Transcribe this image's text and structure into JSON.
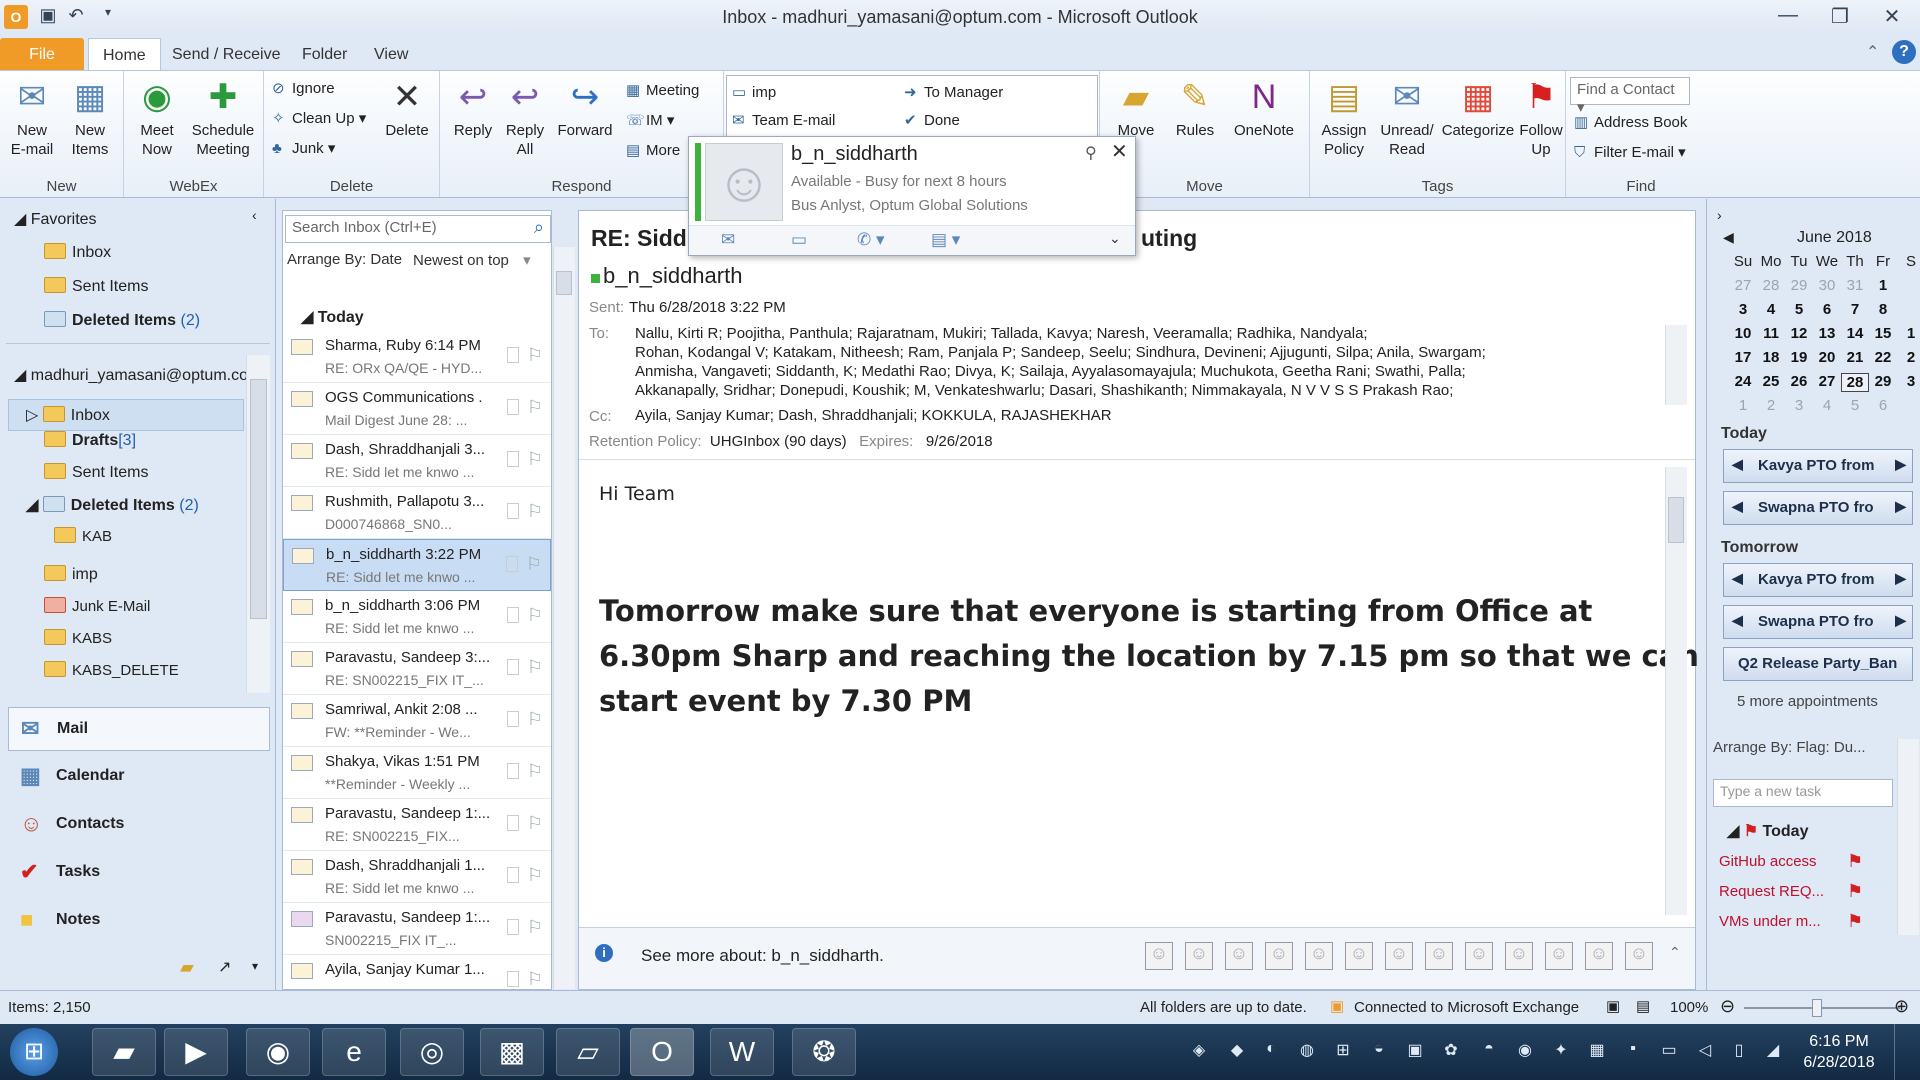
{
  "window": {
    "title": "Inbox - madhuri_yamasani@optum.com - Microsoft Outlook"
  },
  "tabs": [
    "File",
    "Home",
    "Send / Receive",
    "Folder",
    "View"
  ],
  "ribbon": {
    "new": {
      "new_email": "New\nE-mail",
      "new_items": "New\nItems",
      "label": "New"
    },
    "webex": {
      "meet_now": "Meet\nNow",
      "schedule": "Schedule\nMeeting",
      "label": "WebEx"
    },
    "delete": {
      "ignore": "Ignore",
      "clean_up": "Clean Up",
      "junk": "Junk",
      "delete": "Delete",
      "label": "Delete"
    },
    "respond": {
      "reply": "Reply",
      "reply_all": "Reply\nAll",
      "forward": "Forward",
      "meeting": "Meeting",
      "im": "IM",
      "more": "More",
      "label": "Respond"
    },
    "quick_steps": [
      "imp",
      "To Manager",
      "Team E-mail",
      "Done"
    ],
    "move": {
      "move": "Move",
      "rules": "Rules",
      "onenote": "OneNote",
      "label": "Move"
    },
    "tags": {
      "assign_policy": "Assign\nPolicy",
      "unread_read": "Unread/\nRead",
      "categorize": "Categorize",
      "follow_up": "Follow\nUp",
      "label": "Tags"
    },
    "find": {
      "find_contact": "Find a Contact",
      "address_book": "Address Book",
      "filter_email": "Filter E-mail",
      "label": "Find"
    }
  },
  "nav": {
    "favorites": "Favorites",
    "fav_items": [
      {
        "label": "Inbox"
      },
      {
        "label": "Sent Items"
      },
      {
        "label": "Deleted Items",
        "count": "(2)"
      }
    ],
    "account": "madhuri_yamasani@optum.co",
    "folders": [
      {
        "label": "Inbox"
      },
      {
        "label": "Drafts",
        "count": "[3]"
      },
      {
        "label": "Sent Items"
      },
      {
        "label": "Deleted Items",
        "count": "(2)"
      },
      {
        "label": "KAB"
      },
      {
        "label": "imp"
      },
      {
        "label": "Junk E-Mail"
      },
      {
        "label": "KABS"
      },
      {
        "label": "KABS_DELETE"
      }
    ],
    "modules": [
      "Mail",
      "Calendar",
      "Contacts",
      "Tasks",
      "Notes"
    ]
  },
  "list": {
    "search_placeholder": "Search Inbox (Ctrl+E)",
    "arrange": "Arrange By: Date",
    "order": "Newest on top",
    "group": "Today",
    "messages": [
      {
        "from": "Sharma, Ruby 6:14 PM",
        "subject": "RE: ORx QA/QE - HYD..."
      },
      {
        "from": "OGS Communications .",
        "subject": "Mail Digest June 28: ..."
      },
      {
        "from": "Dash, Shraddhanjali 3...",
        "subject": "RE: Sidd let me knwo ..."
      },
      {
        "from": "Rushmith, Pallapotu 3...",
        "subject": "D000746868_SN0..."
      },
      {
        "from": "b_n_siddharth  3:22 PM",
        "subject": "RE: Sidd let me knwo ..."
      },
      {
        "from": "b_n_siddharth  3:06 PM",
        "subject": "RE: Sidd let me knwo ..."
      },
      {
        "from": "Paravastu, Sandeep 3:...",
        "subject": "RE: SN002215_FIX IT_..."
      },
      {
        "from": "Samriwal, Ankit  2:08 ...",
        "subject": "FW: **Reminder - We..."
      },
      {
        "from": "Shakya, Vikas  1:51 PM",
        "subject": "**Reminder - Weekly ..."
      },
      {
        "from": "Paravastu, Sandeep 1:...",
        "subject": "RE: SN002215_FIX..."
      },
      {
        "from": "Dash, Shraddhanjali 1...",
        "subject": "RE: Sidd let me knwo ..."
      },
      {
        "from": "Paravastu, Sandeep 1:...",
        "subject": "SN002215_FIX IT_..."
      },
      {
        "from": "Ayila, Sanjay Kumar 1...",
        "subject": ""
      }
    ]
  },
  "reading": {
    "subject_left": "RE: Sidd",
    "subject_right": "uting",
    "sender": "b_n_siddharth",
    "sent_label": "Sent:",
    "sent": "Thu 6/28/2018 3:22 PM",
    "to_label": "To:",
    "to_lines": [
      "Nallu, Kirti R; Poojitha, Panthula; Rajaratnam, Mukiri; Tallada, Kavya; Naresh, Veeramalla; Radhika, Nandyala;",
      "Rohan, Kodangal V; Katakam, Nitheesh; Ram, Panjala P; Sandeep, Seelu; Sindhura, Devineni; Ajjugunti, Silpa; Anila, Swargam;",
      "Anmisha, Vangaveti; Siddanth, K; Medathi Rao; Divya, K; Sailaja, Ayyalasomayajula; Muchukota, Geetha Rani; Swathi, Palla;",
      "Akkanapally, Sridhar; Donepudi, Koushik; M, Venkateshwarlu; Dasari, Shashikanth; Nimmakayala, N V V S S Prakash Rao;"
    ],
    "cc_label": "Cc:",
    "cc": "Ayila, Sanjay Kumar; Dash, Shraddhanjali; KOKKULA, RAJASHEKHAR",
    "retention_label": "Retention Policy:",
    "retention": "UHGInbox (90 days)",
    "expires_label": "Expires:",
    "expires": "9/26/2018",
    "greeting": "Hi Team",
    "body_lines": [
      "Tomorrow make sure that everyone is starting  from Office at",
      "6.30pm  Sharp  and reaching  the location  by 7.15 pm so that we can",
      "start event by 7.30 PM"
    ],
    "see_more": "See more about: b_n_siddharth."
  },
  "card": {
    "name": "b_n_siddharth",
    "status": "Available - Busy for next 8 hours",
    "title": "Bus Anlyst, Optum Global Solutions"
  },
  "todo": {
    "month": "June 2018",
    "weekdays": [
      "Su",
      "Mo",
      "Tu",
      "We",
      "Th",
      "Fr",
      "S"
    ],
    "weeks": [
      [
        "27",
        "28",
        "29",
        "30",
        "31",
        "1",
        ""
      ],
      [
        "3",
        "4",
        "5",
        "6",
        "7",
        "8",
        ""
      ],
      [
        "10",
        "11",
        "12",
        "13",
        "14",
        "15",
        "1"
      ],
      [
        "17",
        "18",
        "19",
        "20",
        "21",
        "22",
        "2"
      ],
      [
        "24",
        "25",
        "26",
        "27",
        "28",
        "29",
        "3"
      ],
      [
        "1",
        "2",
        "3",
        "4",
        "5",
        "6",
        ""
      ]
    ],
    "today_label": "Today",
    "today_appts": [
      "Kavya PTO from",
      "Swapna PTO fro"
    ],
    "tomorrow_label": "Tomorrow",
    "tomorrow_appts": [
      "Kavya PTO from",
      "Swapna PTO fro",
      "Q2 Release  Party_Ban"
    ],
    "more_appts": "5 more appointments",
    "arrange": "Arrange By: Flag: Du...",
    "new_task_placeholder": "Type a new task",
    "task_group": "Today",
    "tasks": [
      "GitHub access",
      "Request REQ...",
      "VMs under m..."
    ]
  },
  "status": {
    "items": "Items: 2,150",
    "sync": "All folders are up to date.",
    "connection": "Connected to Microsoft Exchange",
    "zoom": "100%"
  },
  "taskbar": {
    "time": "6:16 PM",
    "date": "6/28/2018"
  },
  "colors": {
    "accent": "#f09a28",
    "selection": "#c8ddf4",
    "task_red": "#c0102a"
  }
}
